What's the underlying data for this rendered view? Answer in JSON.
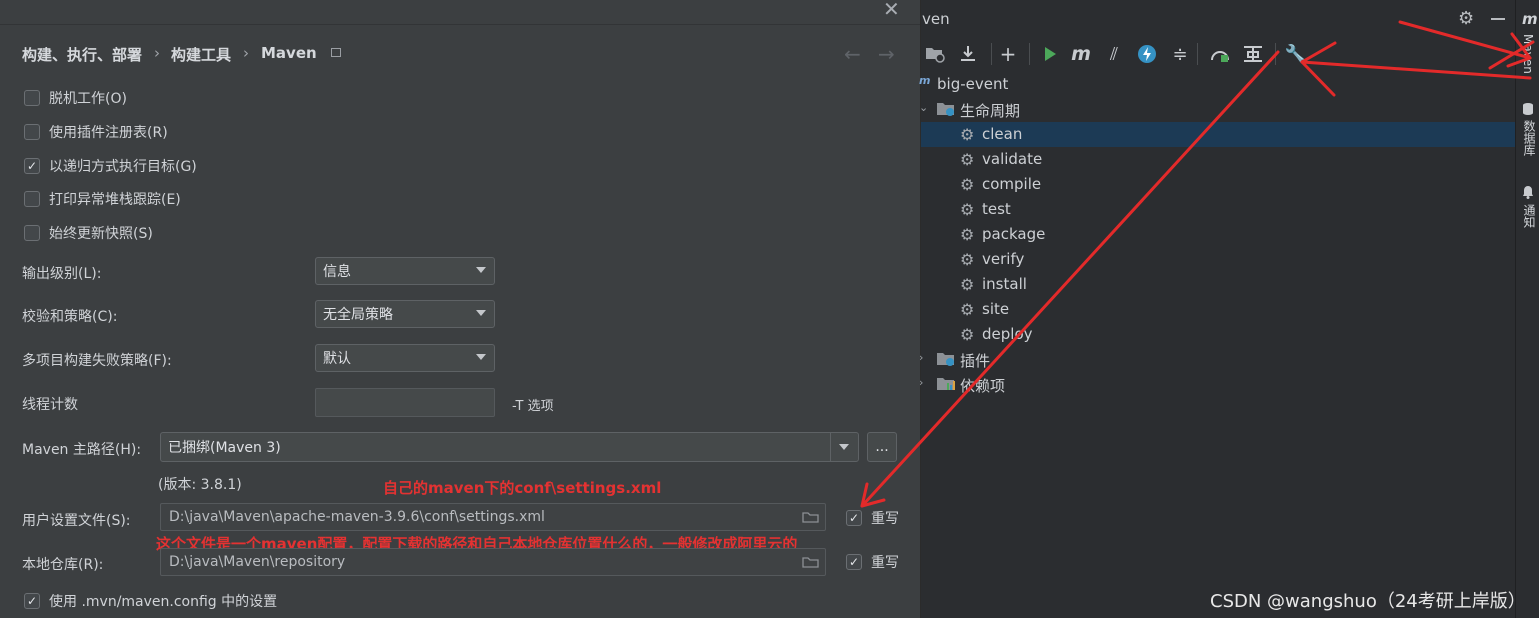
{
  "dialog": {
    "breadcrumb": [
      "构建、执行、部署",
      "构建工具",
      "Maven"
    ],
    "checkboxes": [
      {
        "label": "脱机工作(O)",
        "checked": false
      },
      {
        "label": "使用插件注册表(R)",
        "checked": false
      },
      {
        "label": "以递归方式执行目标(G)",
        "checked": true
      },
      {
        "label": "打印异常堆栈跟踪(E)",
        "checked": false
      },
      {
        "label": "始终更新快照(S)",
        "checked": false
      }
    ],
    "output_level": {
      "label": "输出级别(L):",
      "value": "信息"
    },
    "checksum_policy": {
      "label": "校验和策略(C):",
      "value": "无全局策略"
    },
    "multiproject_fail": {
      "label": "多项目构建失败策略(F):",
      "value": "默认"
    },
    "thread_count": {
      "label": "线程计数",
      "value": "",
      "suffix": "-T 选项"
    },
    "maven_home": {
      "label": "Maven 主路径(H):",
      "value": "已捆绑(Maven 3)",
      "browse": "...",
      "version": "(版本: 3.8.1)"
    },
    "user_settings": {
      "label": "用户设置文件(S):",
      "value": "D:\\java\\Maven\\apache-maven-3.9.6\\conf\\settings.xml",
      "override_label": "重写",
      "override_checked": true
    },
    "local_repo": {
      "label": "本地仓库(R):",
      "value": "D:\\java\\Maven\\repository",
      "override_label": "重写",
      "override_checked": true
    },
    "use_mvn_config": {
      "label": "使用 .mvn/maven.config 中的设置",
      "checked": true
    }
  },
  "annotations": {
    "settings_note": "自己的maven下的conf\\settings.xml",
    "file_note": "这个文件是一个maven配置，配置下载的路径和自己本地仓库位置什么的，一般修改成阿里云的"
  },
  "maven_panel": {
    "title": "ven",
    "project": "big-event",
    "lifecycle_label": "生命周期",
    "lifecycle": [
      "clean",
      "validate",
      "compile",
      "test",
      "package",
      "verify",
      "install",
      "site",
      "deploy"
    ],
    "selected": "clean",
    "plugins_label": "插件",
    "dependencies_label": "依赖项"
  },
  "side_tabs": [
    "Maven",
    "数据库",
    "通知"
  ],
  "watermark": "CSDN @wangshuo（24考研上岸版）",
  "colors": {
    "selection": "#1c3a55",
    "annotation_red": "#e32a2a",
    "run_green": "#4ca85a",
    "accent_blue": "#3592c4"
  }
}
